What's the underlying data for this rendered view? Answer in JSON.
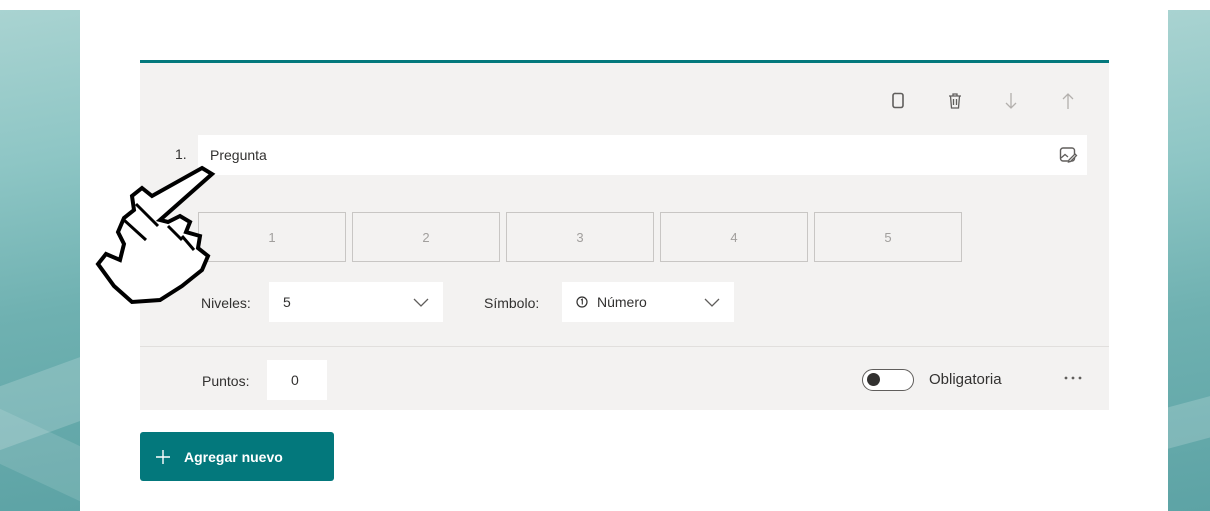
{
  "question": {
    "number": "1.",
    "placeholder": "Pregunta"
  },
  "rating": {
    "options": [
      "1",
      "2",
      "3",
      "4",
      "5"
    ]
  },
  "levels": {
    "label": "Niveles:",
    "value": "5"
  },
  "symbol": {
    "label": "Símbolo:",
    "value": "Número"
  },
  "points": {
    "label": "Puntos:",
    "value": "0"
  },
  "required": {
    "label": "Obligatoria",
    "on": false
  },
  "add_button": {
    "label": "Agregar nuevo"
  },
  "icons": {
    "copy": "copy-icon",
    "delete": "trash-icon",
    "move_down": "arrow-down-icon",
    "move_up": "arrow-up-icon",
    "edit": "edit-image-icon",
    "more": "more-icon"
  },
  "colors": {
    "accent": "#03787c",
    "card_bg": "#f3f2f1"
  }
}
